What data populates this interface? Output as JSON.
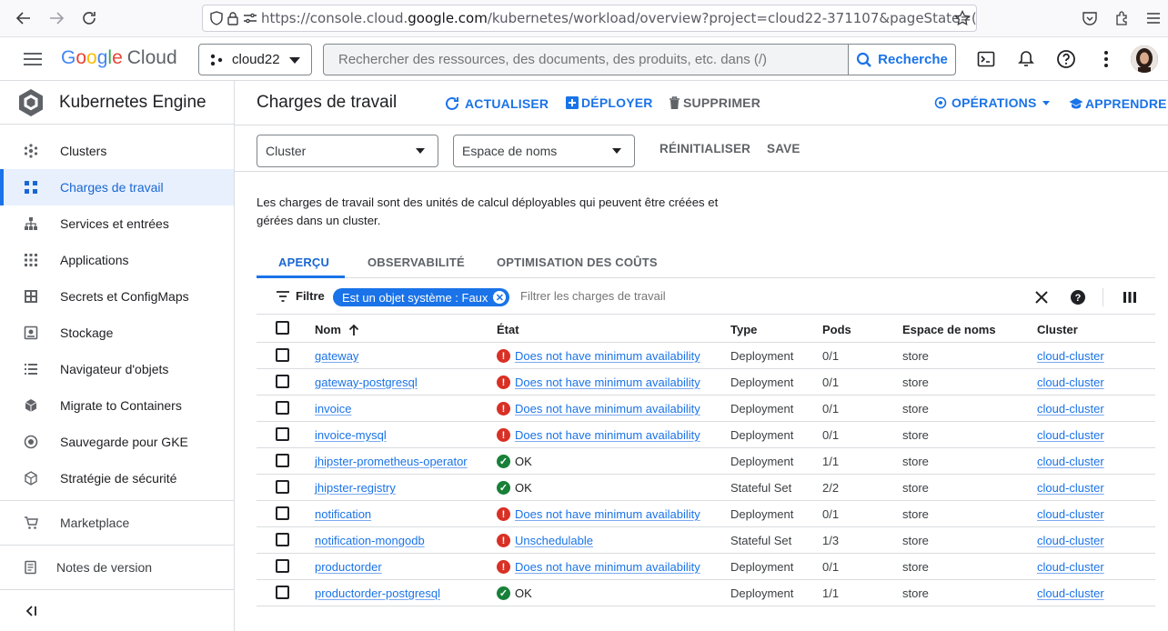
{
  "browser": {
    "url_prefix": "https://console.cloud.",
    "url_host": "google.com",
    "url_rest": "/kubernetes/workload/overview?project=cloud22-371107&pageState=("
  },
  "header": {
    "logo": {
      "g1": "G",
      "g2": "o",
      "g3": "o",
      "g4": "g",
      "g5": "l",
      "g6": "e",
      "cloud": "Cloud"
    },
    "project": "cloud22",
    "search_placeholder": "Rechercher des ressources, des documents, des produits, etc. dans (/)",
    "search_button": "Recherche"
  },
  "sidebar": {
    "product": "Kubernetes Engine",
    "items": [
      {
        "label": "Clusters",
        "icon": "clusters-icon"
      },
      {
        "label": "Charges de travail",
        "icon": "workloads-icon",
        "active": true
      },
      {
        "label": "Services et entrées",
        "icon": "services-icon"
      },
      {
        "label": "Applications",
        "icon": "applications-icon"
      },
      {
        "label": "Secrets et ConfigMaps",
        "icon": "secrets-icon"
      },
      {
        "label": "Stockage",
        "icon": "storage-icon"
      },
      {
        "label": "Navigateur d'objets",
        "icon": "object-browser-icon"
      },
      {
        "label": "Migrate to Containers",
        "icon": "migrate-icon"
      },
      {
        "label": "Sauvegarde pour GKE",
        "icon": "backup-icon"
      },
      {
        "label": "Stratégie de sécurité",
        "icon": "security-icon"
      }
    ],
    "marketplace": "Marketplace",
    "release_notes": "Notes de version",
    "collapse": "<|"
  },
  "toolbar": {
    "title": "Charges de travail",
    "refresh": "ACTUALISER",
    "deploy": "DÉPLOYER",
    "delete": "SUPPRIMER",
    "operations": "OPÉRATIONS",
    "learn": "APPRENDRE"
  },
  "filters": {
    "cluster": "Cluster",
    "namespace": "Espace de noms",
    "reset": "RÉINITIALISER",
    "save": "SAVE"
  },
  "description": "Les charges de travail sont des unités de calcul déployables qui peuvent être créées et gérées dans un cluster.",
  "tabs": [
    "APERÇU",
    "OBSERVABILITÉ",
    "OPTIMISATION DES COÛTS"
  ],
  "filter_row": {
    "label": "Filtre",
    "chip": "Est un objet système : Faux",
    "placeholder": "Filtrer les charges de travail"
  },
  "table": {
    "headers": {
      "name": "Nom",
      "status": "État",
      "type": "Type",
      "pods": "Pods",
      "namespace": "Espace de noms",
      "cluster": "Cluster"
    },
    "rows": [
      {
        "name": "gateway",
        "status": "Does not have minimum availability",
        "ok": false,
        "type": "Deployment",
        "pods": "0/1",
        "namespace": "store",
        "cluster": "cloud-cluster"
      },
      {
        "name": "gateway-postgresql",
        "status": "Does not have minimum availability",
        "ok": false,
        "type": "Deployment",
        "pods": "0/1",
        "namespace": "store",
        "cluster": "cloud-cluster"
      },
      {
        "name": "invoice",
        "status": "Does not have minimum availability",
        "ok": false,
        "type": "Deployment",
        "pods": "0/1",
        "namespace": "store",
        "cluster": "cloud-cluster"
      },
      {
        "name": "invoice-mysql",
        "status": "Does not have minimum availability",
        "ok": false,
        "type": "Deployment",
        "pods": "0/1",
        "namespace": "store",
        "cluster": "cloud-cluster"
      },
      {
        "name": "jhipster-prometheus-operator",
        "status": "OK",
        "ok": true,
        "type": "Deployment",
        "pods": "1/1",
        "namespace": "store",
        "cluster": "cloud-cluster"
      },
      {
        "name": "jhipster-registry",
        "status": "OK",
        "ok": true,
        "type": "Stateful Set",
        "pods": "2/2",
        "namespace": "store",
        "cluster": "cloud-cluster"
      },
      {
        "name": "notification",
        "status": "Does not have minimum availability",
        "ok": false,
        "type": "Deployment",
        "pods": "0/1",
        "namespace": "store",
        "cluster": "cloud-cluster"
      },
      {
        "name": "notification-mongodb",
        "status": "Unschedulable",
        "ok": false,
        "type": "Stateful Set",
        "pods": "1/3",
        "namespace": "store",
        "cluster": "cloud-cluster"
      },
      {
        "name": "productorder",
        "status": "Does not have minimum availability",
        "ok": false,
        "type": "Deployment",
        "pods": "0/1",
        "namespace": "store",
        "cluster": "cloud-cluster"
      },
      {
        "name": "productorder-postgresql",
        "status": "OK",
        "ok": true,
        "type": "Deployment",
        "pods": "1/1",
        "namespace": "store",
        "cluster": "cloud-cluster"
      }
    ]
  },
  "colors": {
    "accent": "#1a73e8",
    "error": "#d93025",
    "ok": "#188038"
  }
}
